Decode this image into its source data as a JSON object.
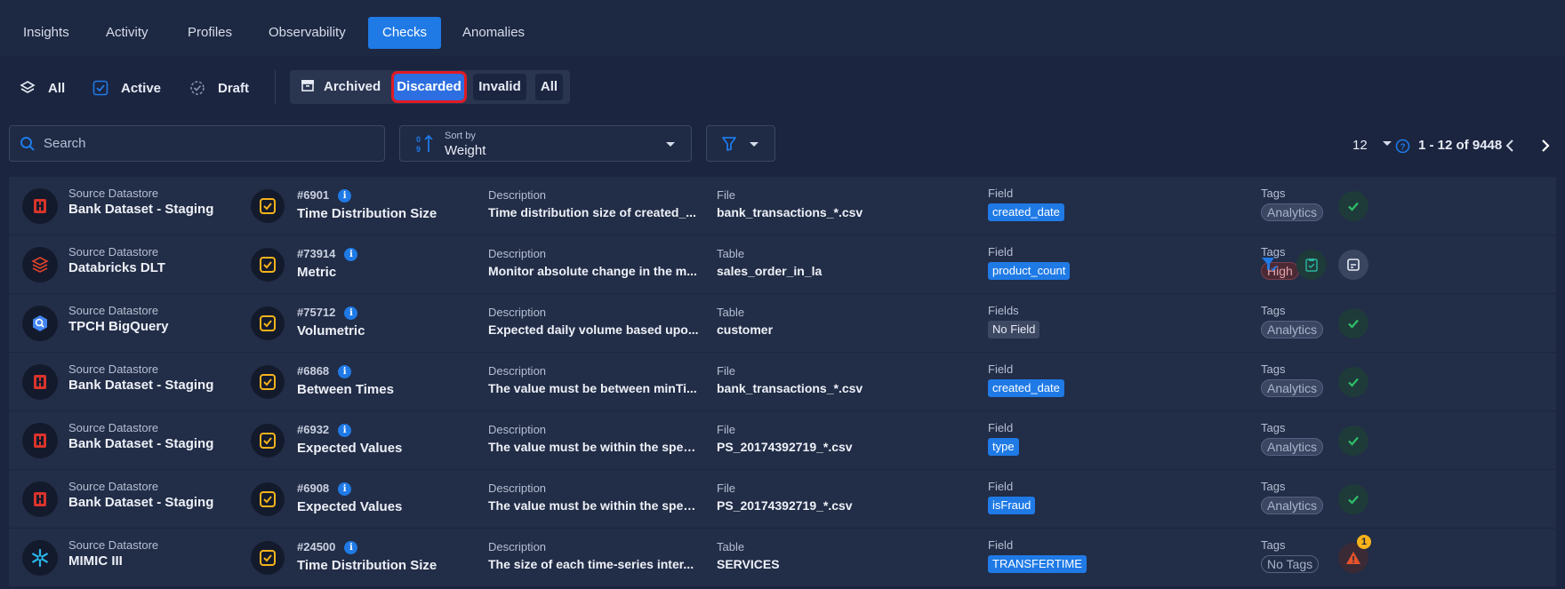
{
  "tabs": [
    {
      "label": "Insights",
      "active": false
    },
    {
      "label": "Activity",
      "active": false
    },
    {
      "label": "Profiles",
      "active": false
    },
    {
      "label": "Observability",
      "active": false
    },
    {
      "label": "Checks",
      "active": true
    },
    {
      "label": "Anomalies",
      "active": false
    }
  ],
  "status_filters": {
    "all": "All",
    "active": "Active",
    "draft": "Draft",
    "archived": "Archived",
    "discarded": "Discarded",
    "invalid": "Invalid",
    "archived_all": "All",
    "selected": "Discarded"
  },
  "search": {
    "placeholder": "Search"
  },
  "sort": {
    "label": "Sort by",
    "value": "Weight"
  },
  "pagination": {
    "per_page": "12",
    "range": "1 - 12 of 9448"
  },
  "colors": {
    "accent": "#1f7ae6",
    "background": "#1b2540",
    "row": "#222d47",
    "check_icon": "#f6b31a",
    "ok": "#2fbf6a",
    "alert": "#e5542b"
  },
  "labels": {
    "source_datastore": "Source Datastore",
    "description": "Description",
    "tags": "Tags"
  },
  "rows": [
    {
      "datastore_icon": "hdfs-icon",
      "datastore": "Bank Dataset - Staging",
      "check_id": "#6901",
      "check_type": "Time Distribution Size",
      "description": "Time distribution size of created_...",
      "container_label": "File",
      "container": "bank_transactions_*.csv",
      "field_label": "Field",
      "field": "created_date",
      "tag": "Analytics",
      "status": "ok"
    },
    {
      "datastore_icon": "databricks-icon",
      "datastore": "Databricks DLT",
      "check_id": "#73914",
      "check_type": "Metric",
      "description": "Monitor absolute change in the m...",
      "container_label": "Table",
      "container": "sales_order_in_la",
      "field_label": "Field",
      "field": "product_count",
      "tag": "High",
      "status": "actions"
    },
    {
      "datastore_icon": "bigquery-icon",
      "datastore": "TPCH BigQuery",
      "check_id": "#75712",
      "check_type": "Volumetric",
      "description": "Expected daily volume based upo...",
      "container_label": "Table",
      "container": "customer",
      "field_label": "Fields",
      "field": "No Field",
      "tag": "Analytics",
      "status": "ok"
    },
    {
      "datastore_icon": "hdfs-icon",
      "datastore": "Bank Dataset - Staging",
      "check_id": "#6868",
      "check_type": "Between Times",
      "description": "The value must be between minTi...",
      "container_label": "File",
      "container": "bank_transactions_*.csv",
      "field_label": "Field",
      "field": "created_date",
      "tag": "Analytics",
      "status": "ok"
    },
    {
      "datastore_icon": "hdfs-icon",
      "datastore": "Bank Dataset - Staging",
      "check_id": "#6932",
      "check_type": "Expected Values",
      "description": "The value must be within the spec...",
      "container_label": "File",
      "container": "PS_20174392719_*.csv",
      "field_label": "Field",
      "field": "type",
      "tag": "Analytics",
      "status": "ok"
    },
    {
      "datastore_icon": "hdfs-icon",
      "datastore": "Bank Dataset - Staging",
      "check_id": "#6908",
      "check_type": "Expected Values",
      "description": "The value must be within the spec...",
      "container_label": "File",
      "container": "PS_20174392719_*.csv",
      "field_label": "Field",
      "field": "isFraud",
      "tag": "Analytics",
      "status": "ok"
    },
    {
      "datastore_icon": "snowflake-icon",
      "datastore": "MIMIC III",
      "check_id": "#24500",
      "check_type": "Time Distribution Size",
      "description": "The size of each time-series inter...",
      "container_label": "Table",
      "container": "SERVICES",
      "field_label": "Field",
      "field": "TRANSFERTIME",
      "tag": "No Tags",
      "status": "alert",
      "alert_count": "1"
    }
  ]
}
